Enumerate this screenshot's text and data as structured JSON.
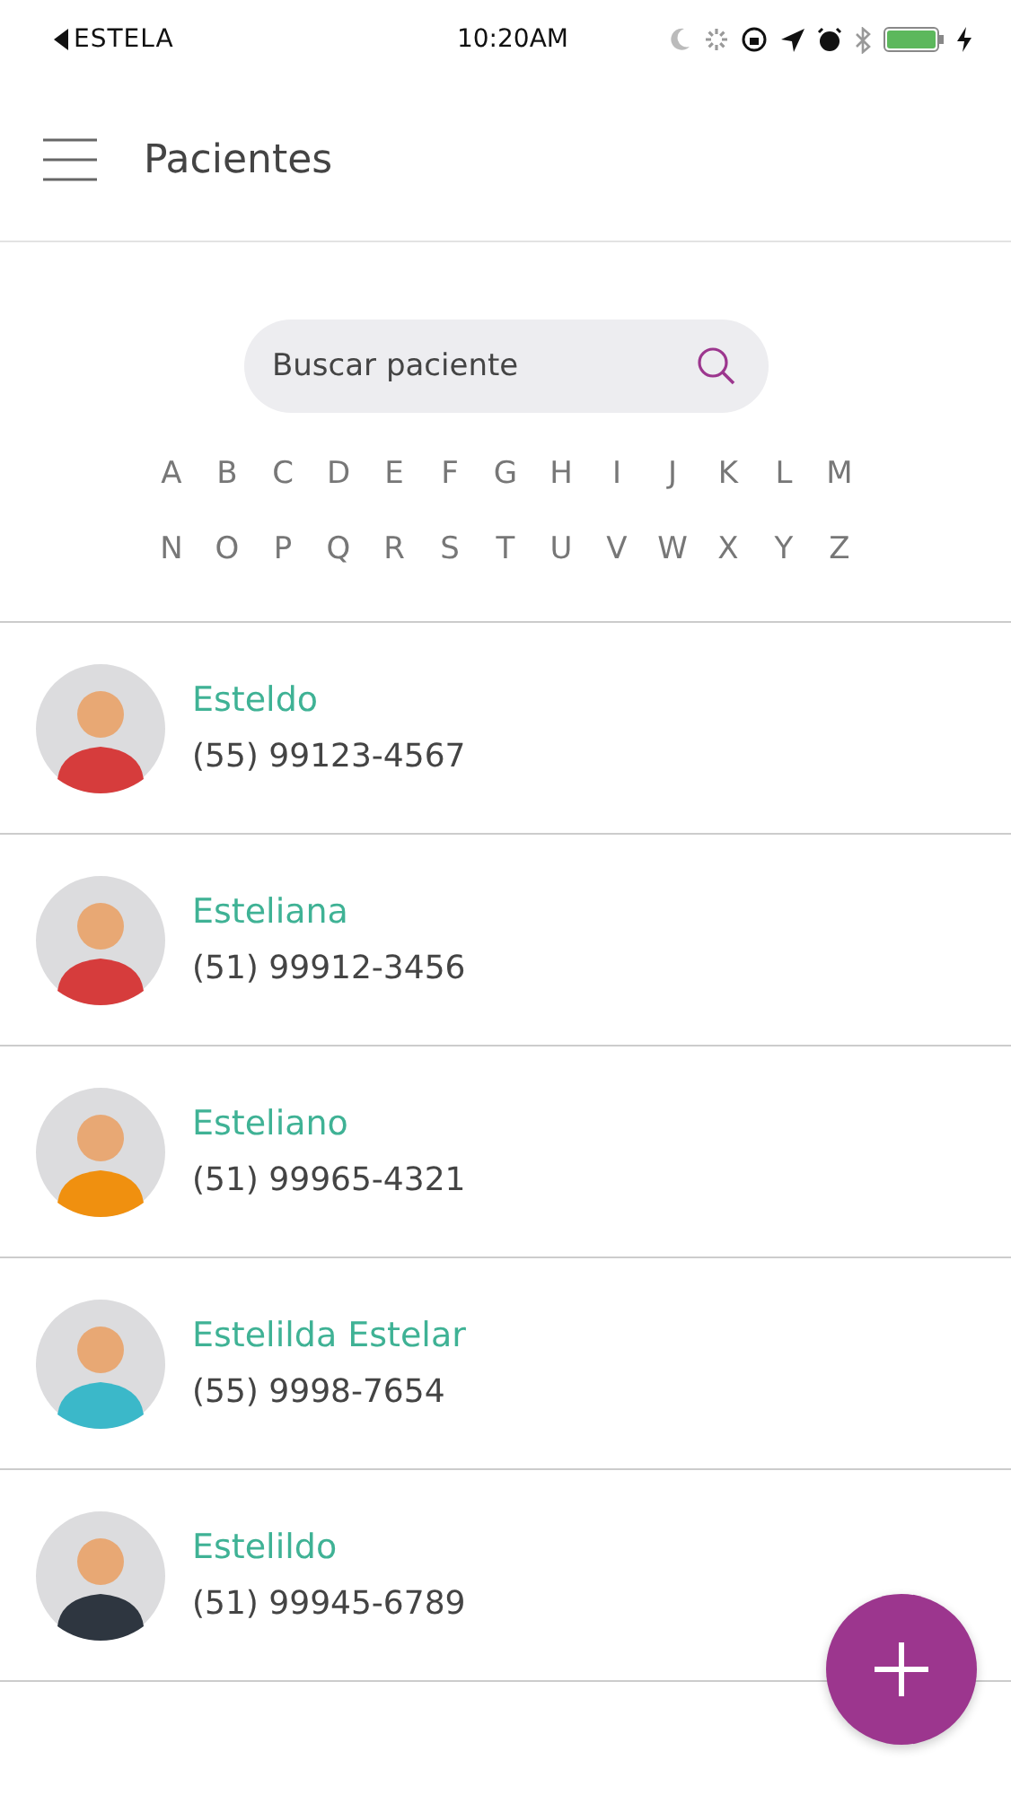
{
  "status_bar": {
    "back_label": "ESTELA",
    "time": "10:20AM"
  },
  "header": {
    "title": "Pacientes"
  },
  "search": {
    "placeholder": "Buscar paciente"
  },
  "alphabet": [
    [
      "A",
      "B",
      "C",
      "D",
      "E",
      "F",
      "G",
      "H",
      "I",
      "J",
      "K",
      "L",
      "M"
    ],
    [
      "N",
      "O",
      "P",
      "Q",
      "R",
      "S",
      "T",
      "U",
      "V",
      "W",
      "X",
      "Y",
      "Z"
    ]
  ],
  "patients": [
    {
      "name": "Esteldo",
      "phone": "(55) 99123-4567",
      "color": "#d63c3c"
    },
    {
      "name": "Esteliana",
      "phone": "(51) 99912-3456",
      "color": "#d63c3c"
    },
    {
      "name": "Esteliano",
      "phone": "(51) 99965-4321",
      "color": "#f0900f"
    },
    {
      "name": "Estelilda Estelar",
      "phone": "(55) 9998-7654",
      "color": "#3bb8c9"
    },
    {
      "name": "Estelildo",
      "phone": "(51) 99945-6789",
      "color": "#2e3640"
    }
  ]
}
